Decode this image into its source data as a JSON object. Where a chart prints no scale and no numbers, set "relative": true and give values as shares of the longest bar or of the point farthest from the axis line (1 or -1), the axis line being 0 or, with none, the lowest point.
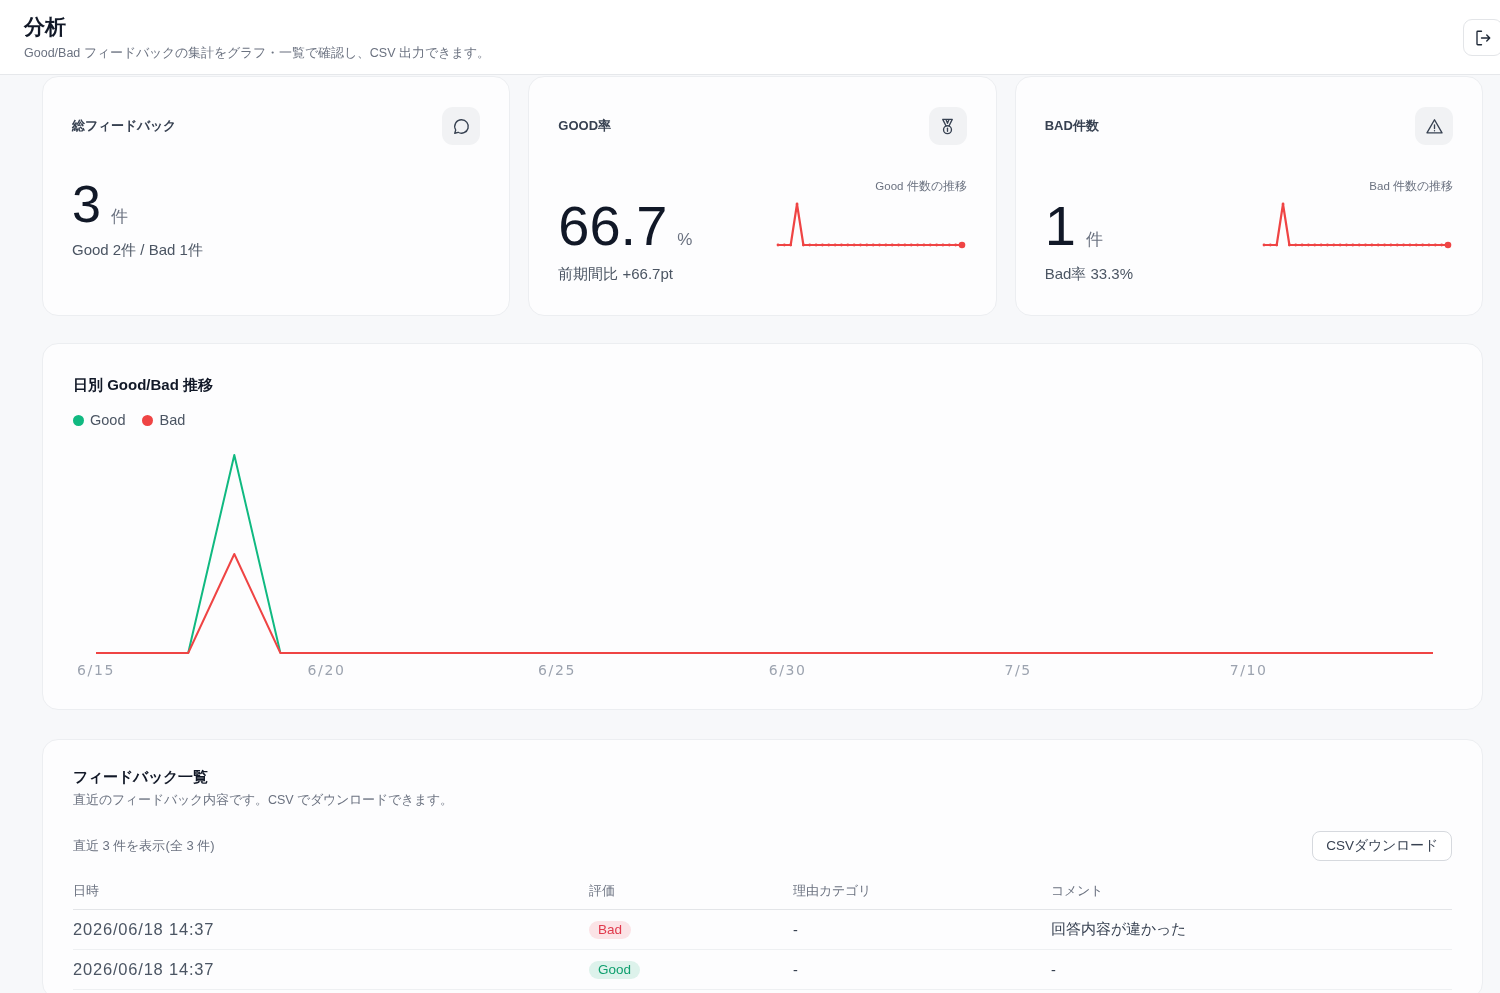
{
  "header": {
    "title": "分析",
    "subtitle": "Good/Bad フィードバックの集計をグラフ・一覧で確認し、CSV 出力できます。"
  },
  "stat_cards": [
    {
      "kind": "total",
      "title": "総フィードバック",
      "value": "3",
      "unit": "件",
      "detail": "Good 2件 / Bad 1件"
    },
    {
      "kind": "rate",
      "title": "GOOD率",
      "value": "66.7",
      "unit": "%",
      "detail": "前期間比 +66.7pt",
      "sparkline_label": "Good 件数の推移"
    },
    {
      "kind": "bad",
      "title": "BAD件数",
      "value": "1",
      "unit": "件",
      "detail": "Bad率 33.3%",
      "sparkline_label": "Bad 件数の推移"
    }
  ],
  "daily_chart": {
    "chart_data": {
      "type": "line",
      "title": "日別 Good/Bad 推移",
      "relative": true,
      "categories": [
        "6/15",
        null,
        null,
        null,
        null,
        "6/20",
        null,
        null,
        null,
        null,
        "6/25",
        null,
        null,
        null,
        null,
        "6/30",
        null,
        null,
        null,
        null,
        "7/5",
        null,
        null,
        null,
        null,
        "7/10",
        null,
        null,
        null,
        null
      ],
      "series": [
        {
          "name": "Good",
          "color": "#10b981",
          "values": [
            null,
            null,
            0,
            1,
            0,
            null,
            null,
            null,
            null,
            null,
            null,
            null,
            null,
            null,
            null,
            null,
            null,
            null,
            null,
            null,
            null,
            null,
            null,
            null,
            null,
            null,
            null,
            null,
            null,
            null
          ]
        },
        {
          "name": "Bad",
          "color": "#ef4444",
          "values": [
            0,
            0,
            0,
            0.5,
            0,
            0,
            0,
            0,
            0,
            0,
            0,
            0,
            0,
            0,
            0,
            0,
            0,
            0,
            0,
            0,
            0,
            0,
            0,
            0,
            0,
            0,
            0,
            0,
            0,
            0
          ]
        }
      ]
    }
  },
  "feedback_list": {
    "title": "フィードバック一覧",
    "description": "直近のフィードバック内容です。CSV でダウンロードできます。",
    "count_label": "直近 3 件を表示(全 3 件)",
    "download_button": "CSVダウンロード",
    "columns": [
      "日時",
      "評価",
      "理由カテゴリ",
      "コメント"
    ],
    "rows": [
      {
        "datetime": "2026/06/18 14:37",
        "rating": {
          "label": "Bad",
          "color": "#e0394c"
        },
        "category": "-",
        "comment": "回答内容が違かった"
      },
      {
        "datetime": "2026/06/18 14:37",
        "rating": {
          "label": "Good",
          "color": "#0f9f6e"
        },
        "category": "-",
        "comment": "-"
      }
    ]
  }
}
